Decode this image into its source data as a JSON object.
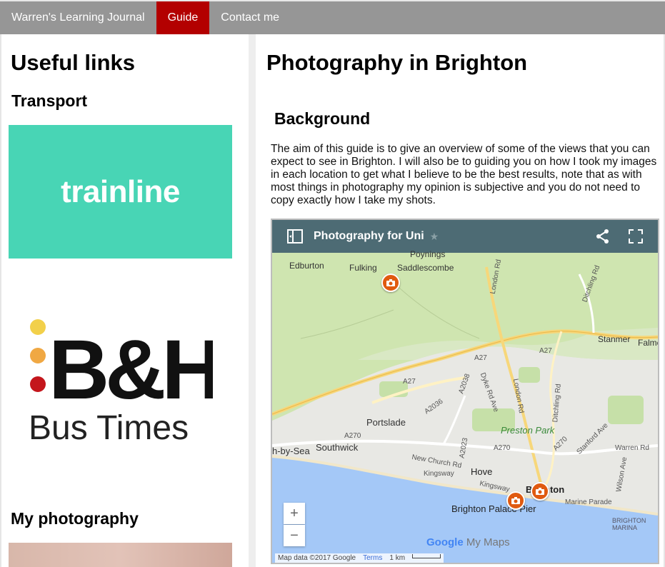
{
  "nav": {
    "items": [
      {
        "label": "Warren's Learning Journal"
      },
      {
        "label": "Guide",
        "active": true
      },
      {
        "label": "Contact me"
      }
    ],
    "active_color": "#b30000",
    "bar_color": "#969696"
  },
  "sidebar": {
    "title": "Useful links",
    "transport_heading": "Transport",
    "trainline_logo": "trainline",
    "bh_logo_text": "B&H",
    "bh_logo_sub": "Bus Times",
    "photography_heading": "My photography"
  },
  "main": {
    "title": "Photography in Brighton",
    "background_heading": "Background",
    "intro": "The aim of this guide is to give an overview of some of the views that you can expect to see in Brighton. I will also be to guiding you on how I took my images in each location to get what I believe to be the best results, note that as with most things in photography my opinion is subjective and you do not need to copy exactly how I take my shots."
  },
  "map": {
    "title": "Photography for Uni",
    "places": {
      "poynings": "Poynings",
      "edburton": "Edburton",
      "fulking": "Fulking",
      "saddlescombe": "Saddlescombe",
      "stanmer": "Stanmer",
      "falmer": "Falme",
      "portslade": "Portslade",
      "southwick": "Southwick",
      "shoreham": "h-by-Sea",
      "preston_park": "Preston Park",
      "hove": "Hove",
      "brighton": "Brighton",
      "palace_pier": "Brighton Palace Pier",
      "marina": "BRIGHTON\nMARINA"
    },
    "roads": {
      "a27_left": "A27",
      "a27_mid": "A27",
      "a27_right": "A27",
      "a2038": "A2038",
      "a2036": "A2036",
      "a270_left": "A270",
      "a270_mid": "A270",
      "a270_right": "A270",
      "a2023": "A2023",
      "london_rd_top": "London Rd",
      "london_rd_mid": "London Rd",
      "dyke_rd": "Dyke Rd Ave",
      "ditchling_rd": "Ditchling Rd",
      "ditchling_rise": "Ditchling Rd",
      "new_church_rd": "New Church Rd",
      "kingsway_left": "Kingsway",
      "kingsway_right": "Kingsway",
      "marine_parade": "Marine Parade",
      "warren_rd": "Warren Rd",
      "wilson_ave": "Wilson Ave",
      "stanford": "Stanford Ave"
    },
    "zoom_in": "+",
    "zoom_out": "−",
    "attribution": "Map data ©2017 Google",
    "terms": "Terms",
    "scale": "1 km",
    "brand_google": "Google",
    "brand_mymaps": "My Maps"
  }
}
